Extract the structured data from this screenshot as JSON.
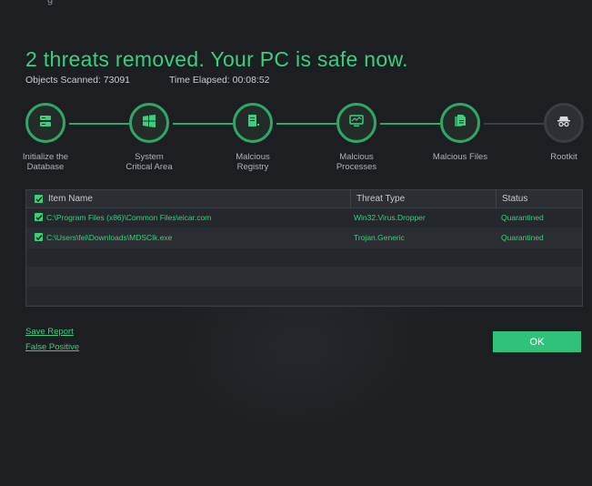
{
  "top_text": "g",
  "headline": "2 threats removed. Your PC is safe now.",
  "stats": {
    "objects_scanned": "Objects Scanned: 73091",
    "time_elapsed": "Time Elapsed: 00:08:52"
  },
  "steps": [
    {
      "label_line1": "Initialize the",
      "label_line2": "Database",
      "icon": "database-icon",
      "state": "done"
    },
    {
      "label_line1": "System",
      "label_line2": "Critical Area",
      "icon": "windows-icon",
      "state": "done"
    },
    {
      "label_line1": "Malcious",
      "label_line2": "Registry",
      "icon": "registry-icon",
      "state": "done"
    },
    {
      "label_line1": "Malcious",
      "label_line2": "Processes",
      "icon": "monitor-icon",
      "state": "done"
    },
    {
      "label_line1": "Malcious Files",
      "label_line2": "",
      "icon": "files-icon",
      "state": "done"
    },
    {
      "label_line1": "Rootkit",
      "label_line2": "",
      "icon": "spy-icon",
      "state": "inactive"
    }
  ],
  "table": {
    "headers": {
      "item": "Item Name",
      "threat": "Threat Type",
      "status": "Status"
    },
    "rows": [
      {
        "path": "C:\\Program Files (x86)\\Common Files\\eicar.com",
        "threat": "Win32.Virus.Dropper",
        "status": "Quarantined"
      },
      {
        "path": "C:\\Users\\fei\\Downloads\\MDSClk.exe",
        "threat": "Trojan.Generic",
        "status": "Quarantined"
      }
    ]
  },
  "links": {
    "save_report": "Save Report",
    "false_positive": "False Positive"
  },
  "ok_label": "OK",
  "colors": {
    "accent": "#3ad07f",
    "background": "#1c1e21"
  }
}
